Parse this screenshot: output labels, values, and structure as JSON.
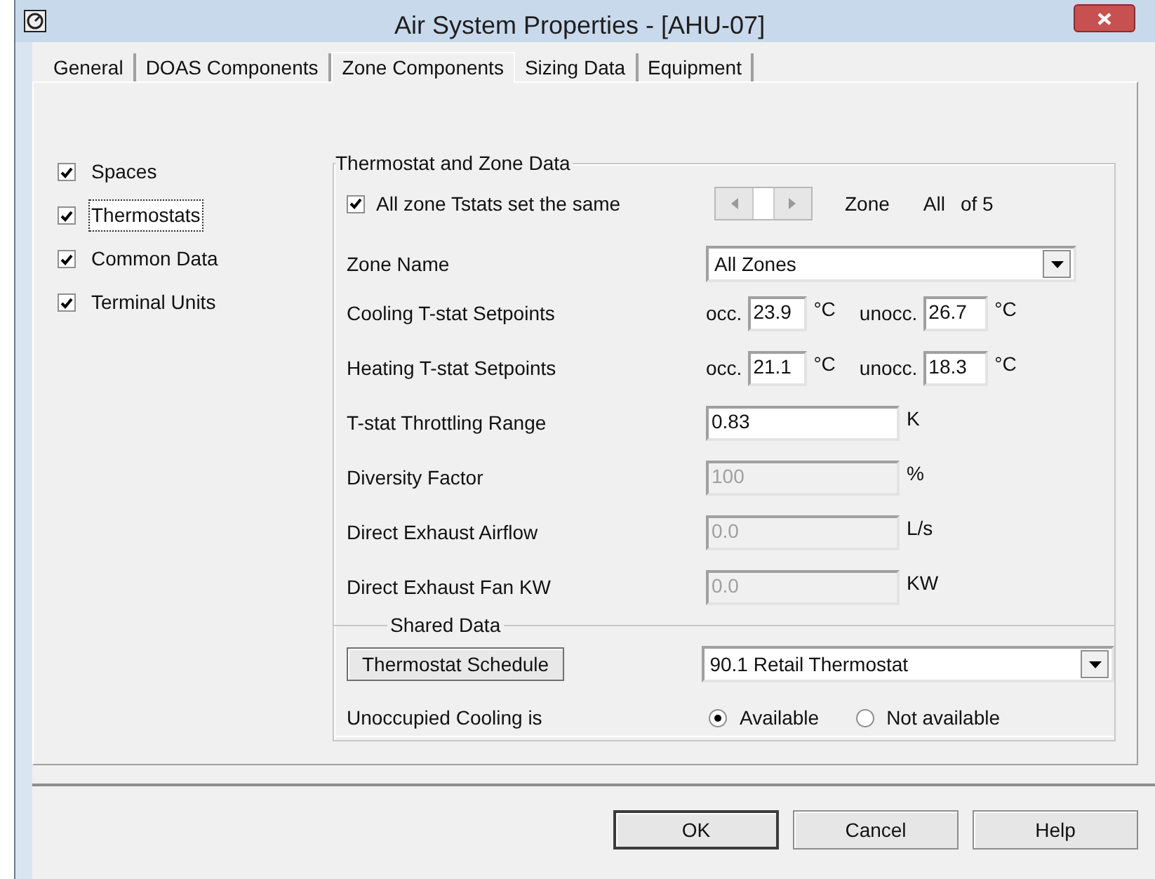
{
  "window": {
    "title": "Air System Properties - [AHU-07]"
  },
  "tabs": [
    {
      "label": "General",
      "selected": false
    },
    {
      "label": "DOAS Components",
      "selected": false
    },
    {
      "label": "Zone Components",
      "selected": true
    },
    {
      "label": "Sizing Data",
      "selected": false
    },
    {
      "label": "Equipment",
      "selected": false
    }
  ],
  "components": [
    {
      "label": "Spaces",
      "checked": true,
      "focused": false
    },
    {
      "label": "Thermostats",
      "checked": true,
      "focused": true
    },
    {
      "label": "Common Data",
      "checked": true,
      "focused": false
    },
    {
      "label": "Terminal Units",
      "checked": true,
      "focused": false
    }
  ],
  "thermostat_group": {
    "title": "Thermostat and Zone Data",
    "same_checkbox": {
      "label": "All zone Tstats set the same",
      "checked": true
    },
    "zone_label": "Zone",
    "zone_value": "All",
    "zone_count": "of 5",
    "zone_name": {
      "label": "Zone Name",
      "value": "All Zones"
    },
    "setpoints": [
      {
        "label": "Cooling T-stat Setpoints",
        "occ_label": "occ.",
        "occ": "23.9",
        "occ_unit": "°C",
        "unocc_label": "unocc.",
        "unocc": "26.7",
        "unocc_unit": "°C"
      },
      {
        "label": "Heating T-stat Setpoints",
        "occ_label": "occ.",
        "occ": "21.1",
        "occ_unit": "°C",
        "unocc_label": "unocc.",
        "unocc": "18.3",
        "unocc_unit": "°C"
      }
    ],
    "fields": [
      {
        "label": "T-stat Throttling Range",
        "value": "0.83",
        "unit": "K",
        "disabled": false
      },
      {
        "label": "Diversity Factor",
        "value": "100",
        "unit": "%",
        "disabled": true
      },
      {
        "label": "Direct Exhaust Airflow",
        "value": "0.0",
        "unit": "L/s",
        "disabled": true
      },
      {
        "label": "Direct Exhaust Fan KW",
        "value": "0.0",
        "unit": "KW",
        "disabled": true
      }
    ]
  },
  "shared_data": {
    "title": "Shared Data",
    "schedule_button": "Thermostat Schedule",
    "schedule": "90.1 Retail Thermostat",
    "unoccupied_label": "Unoccupied Cooling is",
    "options": [
      {
        "label": "Available",
        "selected": true
      },
      {
        "label": "Not available",
        "selected": false
      }
    ]
  },
  "buttons": [
    "OK",
    "Cancel",
    "Help"
  ]
}
